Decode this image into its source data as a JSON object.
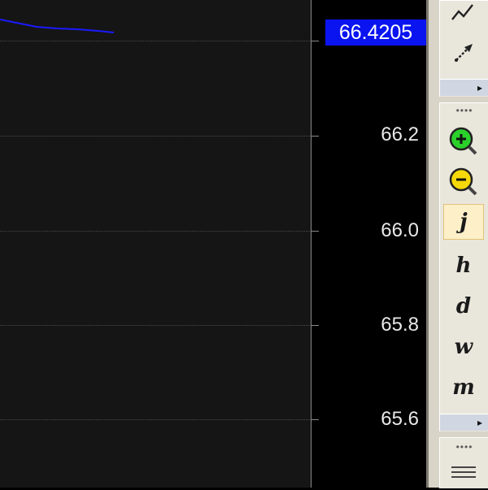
{
  "chart": {
    "price_label": "66.4205",
    "y_ticks": [
      {
        "label": "66.2"
      },
      {
        "label": "66.0"
      },
      {
        "label": "65.8"
      },
      {
        "label": "65.6"
      }
    ],
    "line_color": "#1a1aff",
    "badge_color": "#0a14f0"
  },
  "toolbar": {
    "drawing_tools": [
      {
        "icon": "trend-line-icon"
      },
      {
        "icon": "pointer-arrow-icon"
      }
    ],
    "zoom_tools": [
      {
        "icon": "zoom-in-icon"
      },
      {
        "icon": "zoom-out-icon"
      }
    ],
    "periods": [
      {
        "label": "j",
        "active": true
      },
      {
        "label": "h",
        "active": false
      },
      {
        "label": "d",
        "active": false
      },
      {
        "label": "w",
        "active": false
      },
      {
        "label": "m",
        "active": false
      }
    ],
    "grip": "••••",
    "expand": "▸",
    "menu_icon": "hamburger-menu-icon"
  }
}
